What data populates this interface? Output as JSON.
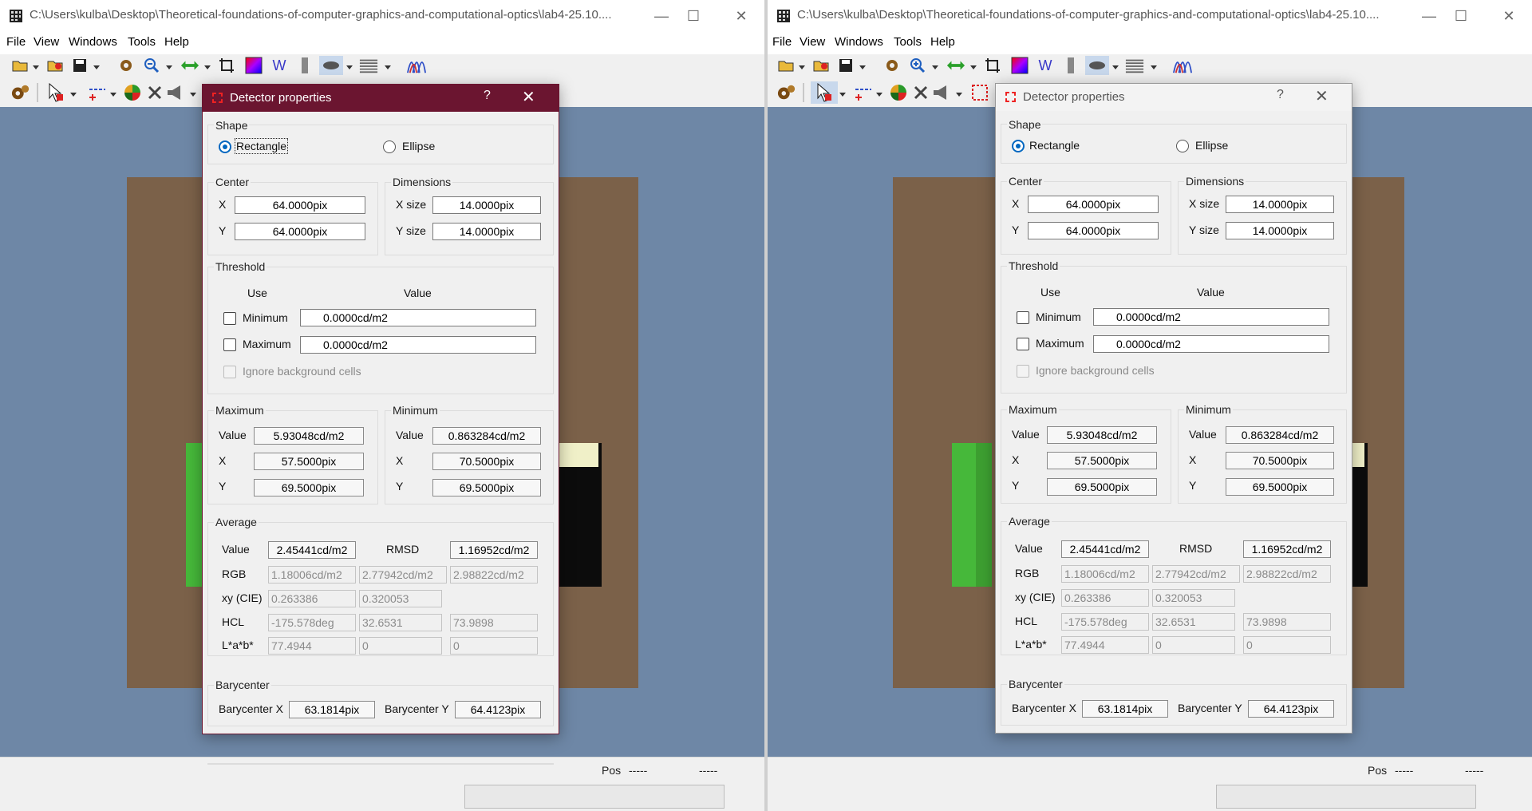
{
  "window": {
    "title": "C:\\Users\\kulba\\Desktop\\Theoretical-foundations-of-computer-graphics-and-computational-optics\\lab4-25.10....",
    "minimize_glyph": "—",
    "maximize_glyph": "☐",
    "close_glyph": "✕"
  },
  "menu": {
    "file": "File",
    "view": "View",
    "windows": "Windows",
    "tools": "Tools",
    "help": "Help"
  },
  "toolbar_icons": [
    "open-icon",
    "open-recent-icon",
    "save-icon",
    "settings-icon",
    "zoom-icon",
    "pan-arrows-icon",
    "crop-icon",
    "color-map-icon",
    "w-icon",
    "bar-icon",
    "ellipse-detector-icon",
    "texture-icon",
    "spectrum-icon",
    "gears-icon",
    "pointer-icon",
    "line-detector-icon",
    "color-wheel-icon",
    "cross-icon",
    "speaker-icon",
    "rect-detector-icon"
  ],
  "toolbar": {
    "w_label": "W"
  },
  "statusbar": {
    "pos_label": "Pos",
    "pos_x": "-----",
    "pos_y": "-----"
  },
  "dialog": {
    "title": "Detector properties",
    "help_glyph": "?",
    "close_glyph": "✕",
    "shape": {
      "label": "Shape",
      "rectangle": "Rectangle",
      "ellipse": "Ellipse",
      "selected": "Rectangle"
    },
    "center": {
      "label": "Center",
      "x_label": "X",
      "x": "64.0000pix",
      "y_label": "Y",
      "y": "64.0000pix"
    },
    "dimensions": {
      "label": "Dimensions",
      "x_label": "X size",
      "x": "14.0000pix",
      "y_label": "Y size",
      "y": "14.0000pix"
    },
    "threshold": {
      "label": "Threshold",
      "use_header": "Use",
      "value_header": "Value",
      "minimum_label": "Minimum",
      "minimum_value": "0.0000cd/m2",
      "maximum_label": "Maximum",
      "maximum_value": "0.0000cd/m2",
      "ignore_label": "Ignore background cells"
    },
    "maximum": {
      "label": "Maximum",
      "value_label": "Value",
      "value": "5.93048cd/m2",
      "x_label": "X",
      "x": "57.5000pix",
      "y_label": "Y",
      "y": "69.5000pix"
    },
    "minimum": {
      "label": "Minimum",
      "value_label": "Value",
      "value": "0.863284cd/m2",
      "x_label": "X",
      "x": "70.5000pix",
      "y_label": "Y",
      "y": "69.5000pix"
    },
    "average": {
      "label": "Average",
      "value_label": "Value",
      "value": "2.45441cd/m2",
      "rmsd_label": "RMSD",
      "rmsd": "1.16952cd/m2",
      "rgb_label": "RGB",
      "rgb": [
        "1.18006cd/m2",
        "2.77942cd/m2",
        "2.98822cd/m2"
      ],
      "xy_label": "xy (CIE)",
      "xy": [
        "0.263386",
        "0.320053"
      ],
      "hcl_label": "HCL",
      "hcl": [
        "-175.578deg",
        "32.6531",
        "73.9898"
      ],
      "lab_label": "L*a*b*",
      "lab": [
        "77.4944",
        "0",
        "0"
      ]
    },
    "barycenter": {
      "label": "Barycenter",
      "x_label": "Barycenter X",
      "x": "63.1814pix",
      "y_label": "Barycenter Y",
      "y": "64.4123pix"
    }
  },
  "colors": {
    "dialog_active_title": "#6b1530",
    "viewport_bg": "#6e87a6",
    "image_bg": "#7b6149",
    "accent": "#0067c0"
  }
}
